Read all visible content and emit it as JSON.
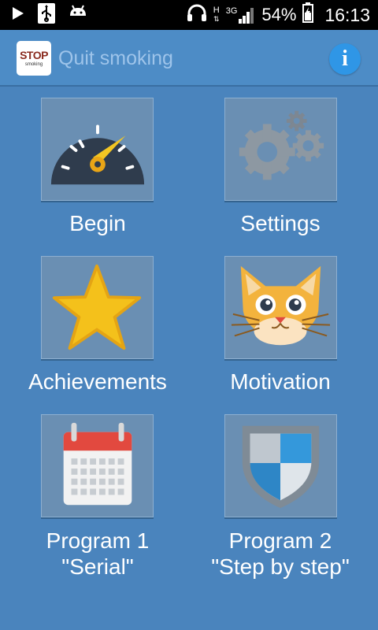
{
  "status_bar": {
    "icons": [
      "play-icon",
      "usb-icon",
      "android-icon",
      "headphones-icon",
      "h-plus-icon",
      "3g-icon",
      "signal-icon",
      "battery-icon"
    ],
    "network_h": "H",
    "network_3g": "3G",
    "battery": "54%",
    "time": "16:13"
  },
  "app_bar": {
    "logo_top": "STOP",
    "logo_bottom": "smoking",
    "title": "Quit smoking",
    "info_icon": "i"
  },
  "menu": {
    "begin": {
      "label": "Begin",
      "icon": "speedometer-icon"
    },
    "settings": {
      "label": "Settings",
      "icon": "gears-icon"
    },
    "achievements": {
      "label": "Achievements",
      "icon": "star-icon"
    },
    "motivation": {
      "label": "Motivation",
      "icon": "cat-icon"
    },
    "program1": {
      "line1": "Program 1",
      "line2": "\"Serial\"",
      "icon": "calendar-icon"
    },
    "program2": {
      "line1": "Program 2",
      "line2": "\"Step by step\"",
      "icon": "shield-icon"
    }
  },
  "colors": {
    "background": "#4a84bd",
    "app_bar": "#4d8cc6",
    "tile": "#6a8fb3",
    "info_button": "#2f96e6",
    "star": "#f4c11b",
    "cat": "#f3b33d"
  }
}
